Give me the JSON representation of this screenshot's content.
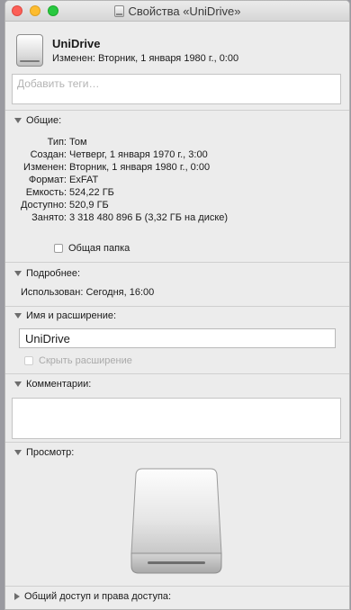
{
  "window": {
    "title": "Свойства «UniDrive»"
  },
  "header": {
    "name": "UniDrive",
    "modified": "Изменен: Вторник, 1 января 1980 г., 0:00"
  },
  "tags": {
    "placeholder": "Добавить теги…"
  },
  "general": {
    "heading": "Общие:",
    "rows": [
      {
        "label": "Тип:",
        "value": "Том"
      },
      {
        "label": "Создан:",
        "value": "Четверг, 1 января 1970 г., 3:00"
      },
      {
        "label": "Изменен:",
        "value": "Вторник, 1 января 1980 г., 0:00"
      },
      {
        "label": "Формат:",
        "value": "ExFAT"
      },
      {
        "label": "Емкость:",
        "value": "524,22 ГБ"
      },
      {
        "label": "Доступно:",
        "value": "520,9 ГБ"
      },
      {
        "label": "Занято:",
        "value": "3 318 480 896 Б (3,32 ГБ на диске)"
      }
    ],
    "shared_folder_label": "Общая папка"
  },
  "more_info": {
    "heading": "Подробнее:",
    "last_used": "Использован: Сегодня, 16:00"
  },
  "name_extension": {
    "heading": "Имя и расширение:",
    "value": "UniDrive",
    "hide_extension_label": "Скрыть расширение"
  },
  "comments": {
    "heading": "Комментарии:"
  },
  "preview": {
    "heading": "Просмотр:"
  },
  "sharing": {
    "heading": "Общий доступ и права доступа:"
  },
  "icons": {
    "title_icon": "drive-icon",
    "header_icon": "external-drive-icon",
    "preview_icon": "external-drive-icon"
  }
}
